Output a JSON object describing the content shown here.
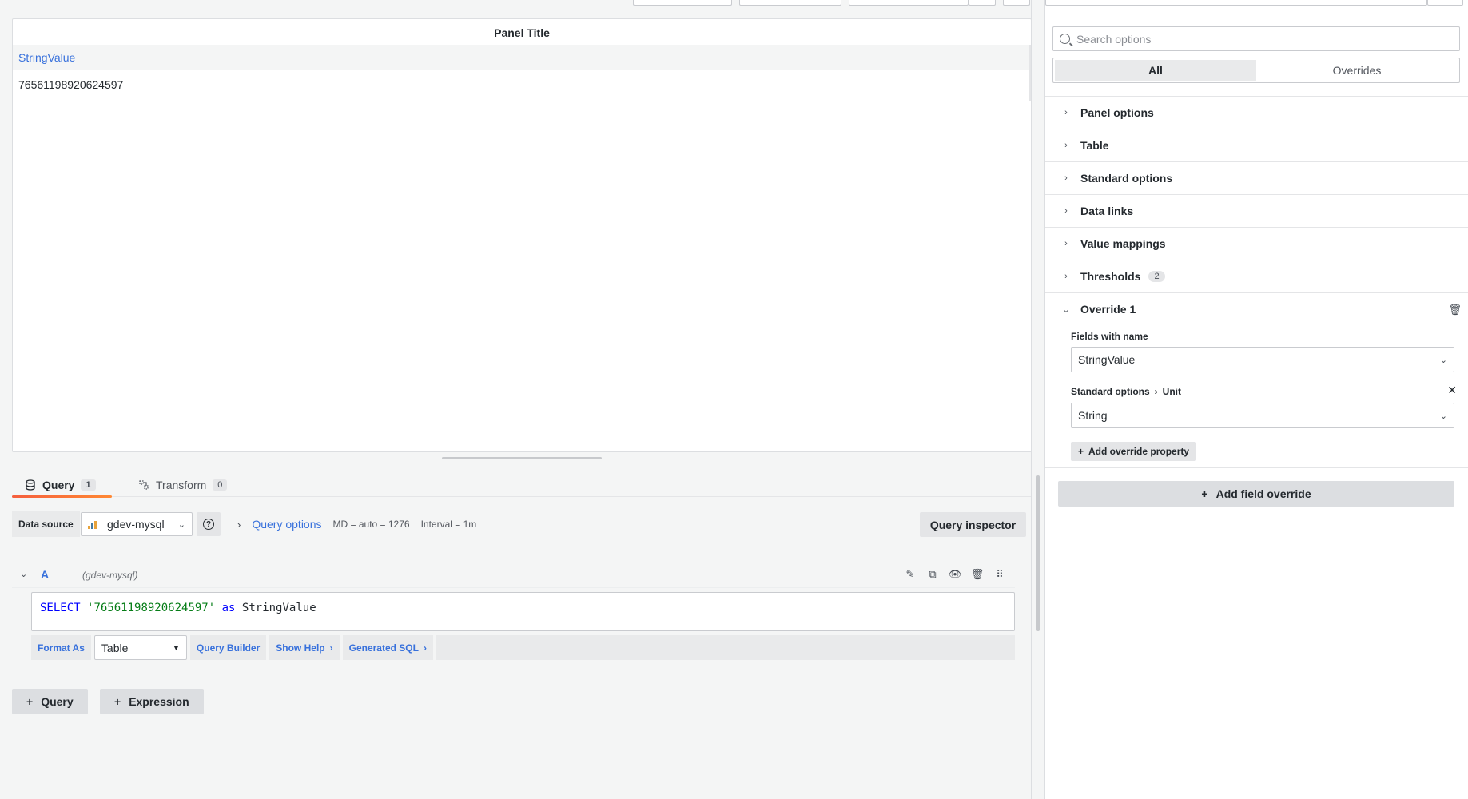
{
  "panel": {
    "title": "Panel Title",
    "table": {
      "columns": [
        "StringValue"
      ],
      "rows": [
        [
          "76561198920624597"
        ]
      ]
    }
  },
  "editor": {
    "tabs": [
      {
        "label": "Query",
        "count": "1"
      },
      {
        "label": "Transform",
        "count": "0"
      }
    ],
    "datasource": {
      "label": "Data source",
      "value": "gdev-mysql"
    },
    "query_options": {
      "label": "Query options",
      "md": "MD = auto = 1276",
      "interval": "Interval = 1m"
    },
    "query_inspector": "Query inspector",
    "query_a": {
      "letter": "A",
      "datasource": "(gdev-mysql)",
      "sql": {
        "kw_select": "SELECT",
        "string": "'76561198920624597'",
        "kw_as": "as",
        "ident": "StringValue"
      },
      "toolbar": {
        "format_as_label": "Format As",
        "format_as_value": "Table",
        "query_builder": "Query Builder",
        "show_help": "Show Help",
        "generated_sql": "Generated SQL"
      }
    },
    "add_query": "Query",
    "add_expression": "Expression"
  },
  "options": {
    "search_placeholder": "Search options",
    "segments": {
      "all": "All",
      "overrides": "Overrides"
    },
    "sections": [
      {
        "label": "Panel options"
      },
      {
        "label": "Table"
      },
      {
        "label": "Standard options"
      },
      {
        "label": "Data links"
      },
      {
        "label": "Value mappings"
      },
      {
        "label": "Thresholds",
        "count": "2"
      }
    ],
    "override": {
      "title": "Override 1",
      "matcher_label": "Fields with name",
      "matcher_value": "StringValue",
      "property_path": "Standard options",
      "property_name": "Unit",
      "property_value": "String",
      "add_property": "Add override property"
    },
    "add_field_override": "Add field override"
  }
}
